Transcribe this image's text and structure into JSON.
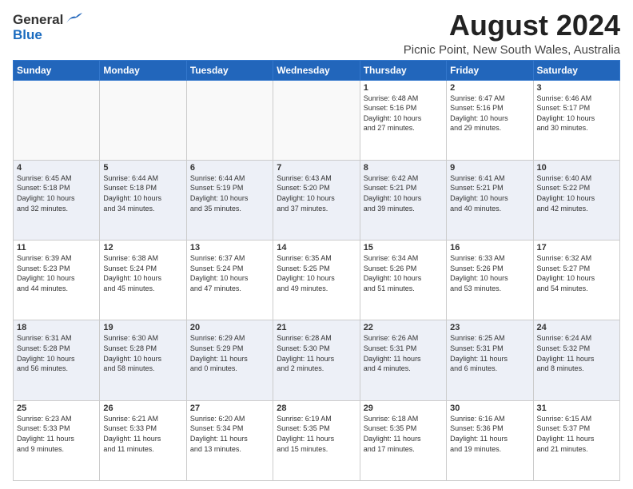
{
  "logo": {
    "general": "General",
    "blue": "Blue"
  },
  "title": "August 2024",
  "subtitle": "Picnic Point, New South Wales, Australia",
  "days_header": [
    "Sunday",
    "Monday",
    "Tuesday",
    "Wednesday",
    "Thursday",
    "Friday",
    "Saturday"
  ],
  "weeks": [
    [
      {
        "day": "",
        "info": ""
      },
      {
        "day": "",
        "info": ""
      },
      {
        "day": "",
        "info": ""
      },
      {
        "day": "",
        "info": ""
      },
      {
        "day": "1",
        "info": "Sunrise: 6:48 AM\nSunset: 5:16 PM\nDaylight: 10 hours\nand 27 minutes."
      },
      {
        "day": "2",
        "info": "Sunrise: 6:47 AM\nSunset: 5:16 PM\nDaylight: 10 hours\nand 29 minutes."
      },
      {
        "day": "3",
        "info": "Sunrise: 6:46 AM\nSunset: 5:17 PM\nDaylight: 10 hours\nand 30 minutes."
      }
    ],
    [
      {
        "day": "4",
        "info": "Sunrise: 6:45 AM\nSunset: 5:18 PM\nDaylight: 10 hours\nand 32 minutes."
      },
      {
        "day": "5",
        "info": "Sunrise: 6:44 AM\nSunset: 5:18 PM\nDaylight: 10 hours\nand 34 minutes."
      },
      {
        "day": "6",
        "info": "Sunrise: 6:44 AM\nSunset: 5:19 PM\nDaylight: 10 hours\nand 35 minutes."
      },
      {
        "day": "7",
        "info": "Sunrise: 6:43 AM\nSunset: 5:20 PM\nDaylight: 10 hours\nand 37 minutes."
      },
      {
        "day": "8",
        "info": "Sunrise: 6:42 AM\nSunset: 5:21 PM\nDaylight: 10 hours\nand 39 minutes."
      },
      {
        "day": "9",
        "info": "Sunrise: 6:41 AM\nSunset: 5:21 PM\nDaylight: 10 hours\nand 40 minutes."
      },
      {
        "day": "10",
        "info": "Sunrise: 6:40 AM\nSunset: 5:22 PM\nDaylight: 10 hours\nand 42 minutes."
      }
    ],
    [
      {
        "day": "11",
        "info": "Sunrise: 6:39 AM\nSunset: 5:23 PM\nDaylight: 10 hours\nand 44 minutes."
      },
      {
        "day": "12",
        "info": "Sunrise: 6:38 AM\nSunset: 5:24 PM\nDaylight: 10 hours\nand 45 minutes."
      },
      {
        "day": "13",
        "info": "Sunrise: 6:37 AM\nSunset: 5:24 PM\nDaylight: 10 hours\nand 47 minutes."
      },
      {
        "day": "14",
        "info": "Sunrise: 6:35 AM\nSunset: 5:25 PM\nDaylight: 10 hours\nand 49 minutes."
      },
      {
        "day": "15",
        "info": "Sunrise: 6:34 AM\nSunset: 5:26 PM\nDaylight: 10 hours\nand 51 minutes."
      },
      {
        "day": "16",
        "info": "Sunrise: 6:33 AM\nSunset: 5:26 PM\nDaylight: 10 hours\nand 53 minutes."
      },
      {
        "day": "17",
        "info": "Sunrise: 6:32 AM\nSunset: 5:27 PM\nDaylight: 10 hours\nand 54 minutes."
      }
    ],
    [
      {
        "day": "18",
        "info": "Sunrise: 6:31 AM\nSunset: 5:28 PM\nDaylight: 10 hours\nand 56 minutes."
      },
      {
        "day": "19",
        "info": "Sunrise: 6:30 AM\nSunset: 5:28 PM\nDaylight: 10 hours\nand 58 minutes."
      },
      {
        "day": "20",
        "info": "Sunrise: 6:29 AM\nSunset: 5:29 PM\nDaylight: 11 hours\nand 0 minutes."
      },
      {
        "day": "21",
        "info": "Sunrise: 6:28 AM\nSunset: 5:30 PM\nDaylight: 11 hours\nand 2 minutes."
      },
      {
        "day": "22",
        "info": "Sunrise: 6:26 AM\nSunset: 5:31 PM\nDaylight: 11 hours\nand 4 minutes."
      },
      {
        "day": "23",
        "info": "Sunrise: 6:25 AM\nSunset: 5:31 PM\nDaylight: 11 hours\nand 6 minutes."
      },
      {
        "day": "24",
        "info": "Sunrise: 6:24 AM\nSunset: 5:32 PM\nDaylight: 11 hours\nand 8 minutes."
      }
    ],
    [
      {
        "day": "25",
        "info": "Sunrise: 6:23 AM\nSunset: 5:33 PM\nDaylight: 11 hours\nand 9 minutes."
      },
      {
        "day": "26",
        "info": "Sunrise: 6:21 AM\nSunset: 5:33 PM\nDaylight: 11 hours\nand 11 minutes."
      },
      {
        "day": "27",
        "info": "Sunrise: 6:20 AM\nSunset: 5:34 PM\nDaylight: 11 hours\nand 13 minutes."
      },
      {
        "day": "28",
        "info": "Sunrise: 6:19 AM\nSunset: 5:35 PM\nDaylight: 11 hours\nand 15 minutes."
      },
      {
        "day": "29",
        "info": "Sunrise: 6:18 AM\nSunset: 5:35 PM\nDaylight: 11 hours\nand 17 minutes."
      },
      {
        "day": "30",
        "info": "Sunrise: 6:16 AM\nSunset: 5:36 PM\nDaylight: 11 hours\nand 19 minutes."
      },
      {
        "day": "31",
        "info": "Sunrise: 6:15 AM\nSunset: 5:37 PM\nDaylight: 11 hours\nand 21 minutes."
      }
    ]
  ]
}
